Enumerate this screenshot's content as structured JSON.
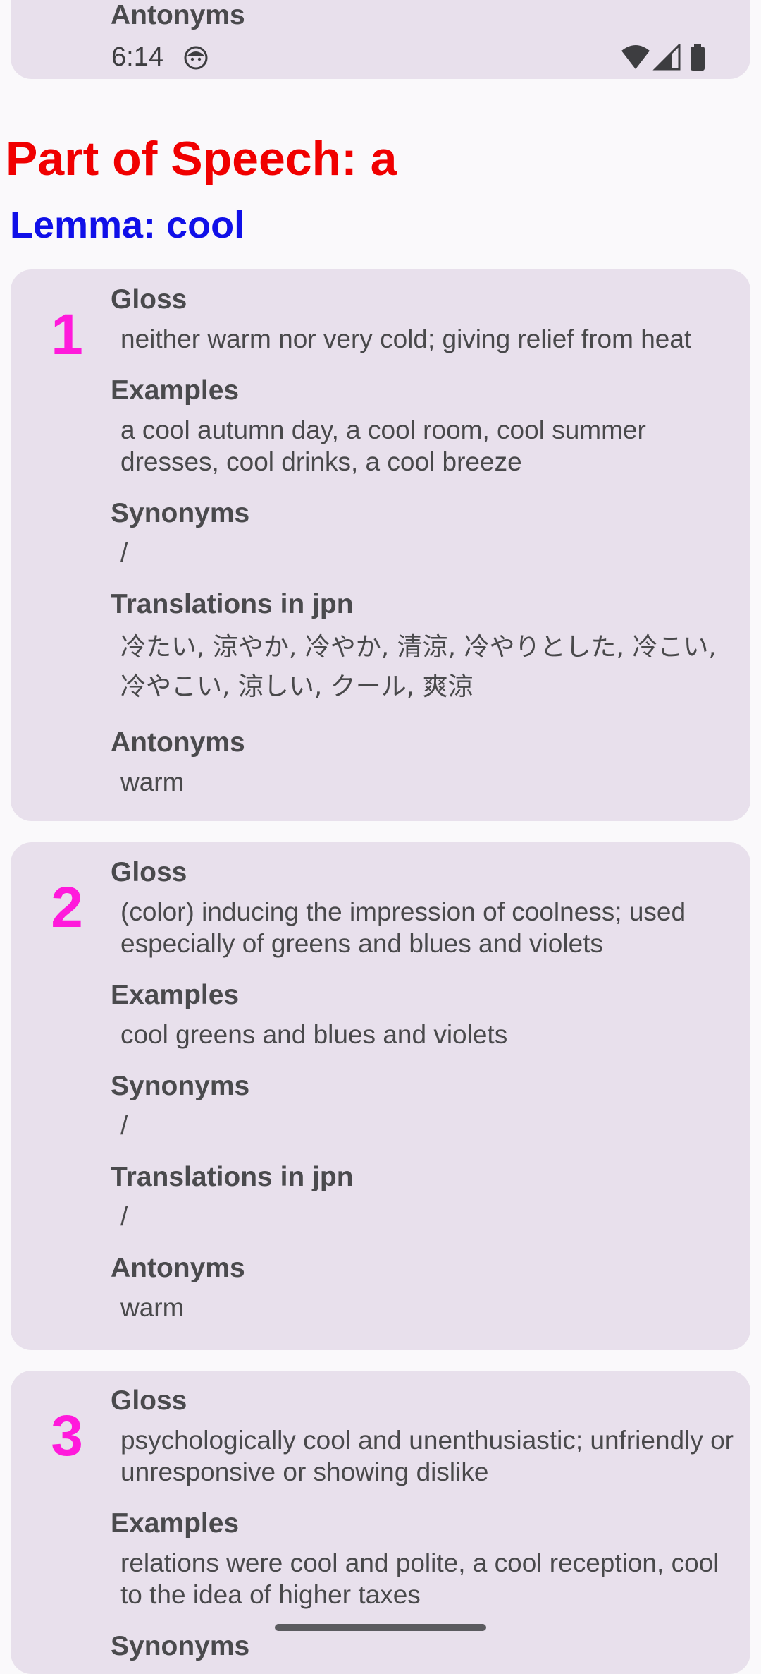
{
  "status_bar": {
    "time": "6:14",
    "icons": [
      "face-icon",
      "wifi-icon",
      "cell-signal-icon",
      "battery-icon"
    ]
  },
  "prev_card": {
    "label": "Antonyms"
  },
  "part_of_speech": "Part of Speech: a",
  "lemma": "Lemma: cool",
  "labels": {
    "gloss": "Gloss",
    "examples": "Examples",
    "synonyms": "Synonyms",
    "translations": "Translations in jpn",
    "antonyms": "Antonyms"
  },
  "senses": [
    {
      "number": "1",
      "gloss": "neither warm nor very cold; giving relief from heat",
      "examples": "a cool autumn day, a cool room, cool summer dresses, cool drinks, a cool breeze",
      "synonyms": "/",
      "translations": "冷たい, 涼やか, 冷やか, 清涼, 冷やりとした, 冷こい, 冷やこい, 涼しい, クール, 爽涼",
      "antonyms": "warm"
    },
    {
      "number": "2",
      "gloss": "(color) inducing the impression of coolness; used especially of greens and blues and violets",
      "examples": "cool greens and blues and violets",
      "synonyms": "/",
      "translations": "/",
      "antonyms": "warm"
    },
    {
      "number": "3",
      "gloss": "psychologically cool and unenthusiastic; unfriendly or unresponsive or showing dislike",
      "examples": "relations were cool and polite, a cool reception, cool to the idea of higher taxes",
      "synonyms_label_partial": "Synonyms"
    }
  ],
  "colors": {
    "part_of_speech": "#f00000",
    "lemma": "#1010e8",
    "sense_number": "#ff1adb",
    "card_background": "#e8e0ec",
    "page_background": "#faf9fb"
  }
}
